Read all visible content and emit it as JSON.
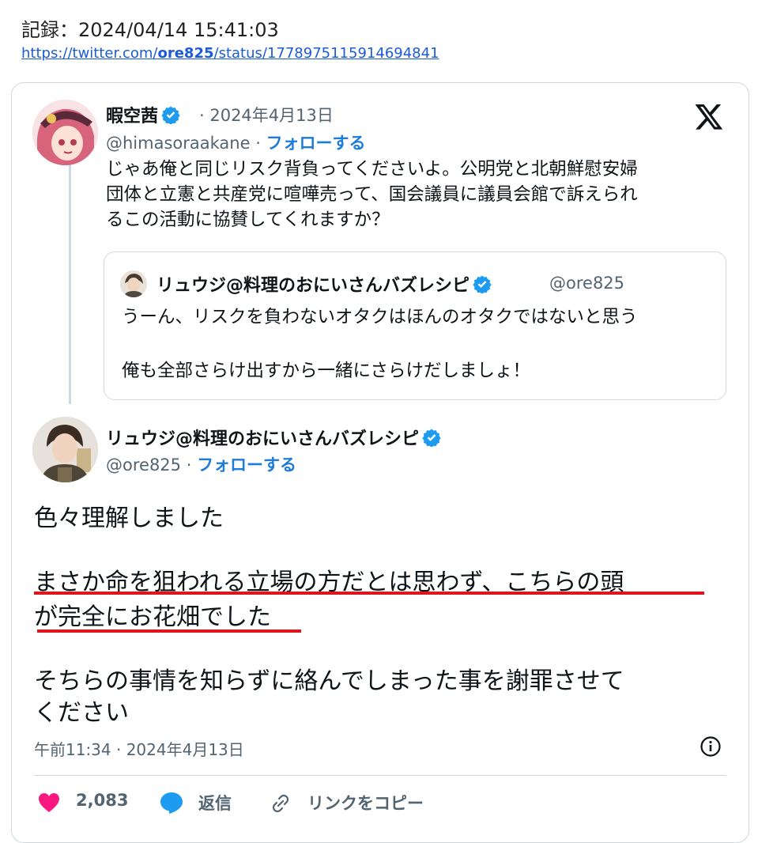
{
  "header": {
    "record_label": "記録：2024/04/14 15:41:03",
    "url_prefix": "https://twitter.com/",
    "url_user": "ore825",
    "url_suffix": "/status/1778975115914694841"
  },
  "reply_tweet": {
    "display_name": "暇空茜",
    "date": "· 2024年4月13日",
    "handle": "@himasoraakane ·",
    "follow_label": "フォローする",
    "text": "じゃあ俺と同じリスク背負ってくださいよ。公明党と北朝鮮慰安婦\n団体と立憲と共産党に喧嘩売って、国会議員に議員会館で訴えられ\nるこの活動に協賛してくれますか？"
  },
  "quoted_tweet": {
    "display_name": "リュウジ@料理のおにいさんバズレシピ",
    "handle": "@ore825",
    "line1": "うーん、リスクを負わないオタクはほんのオタクではないと思う",
    "line2": "俺も全部さらけ出すから一緒にさらけだしましょ！"
  },
  "main_tweet": {
    "display_name": "リュウジ@料理のおにいさんバズレシピ",
    "handle": "@ore825 ·",
    "follow_label": "フォローする",
    "lines": [
      "色々理解しました",
      "まさか命を狙われる立場の方だとは思わず、こちらの頭",
      "が完全にお花畑でした",
      "そちらの事情を知らずに絡んでしまった事を謝罪させて",
      "ください"
    ],
    "timestamp": "午前11:34 · 2024年4月13日"
  },
  "actions": {
    "like_count": "2,083",
    "reply_label": "返信",
    "copy_link_label": "リンクをコピー"
  },
  "colors": {
    "accent": "#1d9bf0",
    "like": "#f91880",
    "underline": "#e0141c"
  },
  "icons": [
    "verified-badge-icon",
    "x-logo-icon",
    "info-icon",
    "heart-icon",
    "reply-bubble-icon",
    "link-icon"
  ]
}
